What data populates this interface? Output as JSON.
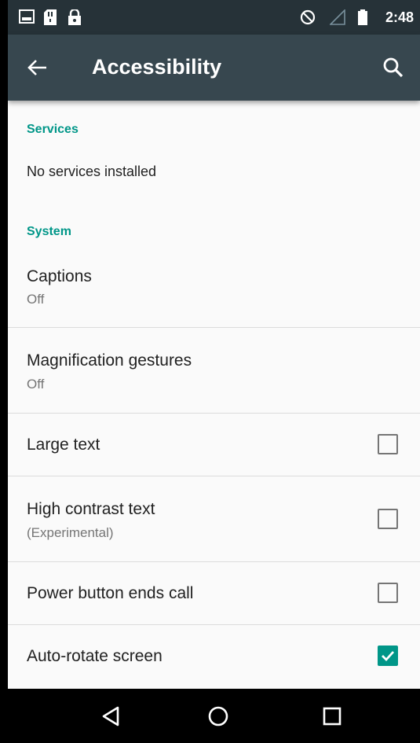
{
  "status_bar": {
    "time": "2:48",
    "icons": [
      "image-icon",
      "sd-card-icon",
      "lock-icon",
      "do-not-disturb-icon",
      "signal-icon",
      "battery-icon"
    ]
  },
  "toolbar": {
    "title": "Accessibility",
    "back_icon": "arrow-back-icon",
    "search_icon": "search-icon"
  },
  "sections": {
    "services": {
      "header": "Services",
      "empty_text": "No services installed"
    },
    "system": {
      "header": "System",
      "items": [
        {
          "title": "Captions",
          "summary": "Off"
        },
        {
          "title": "Magnification gestures",
          "summary": "Off"
        },
        {
          "title": "Large text",
          "checked": false
        },
        {
          "title": "High contrast text",
          "summary": "(Experimental)",
          "checked": false
        },
        {
          "title": "Power button ends call",
          "checked": false
        },
        {
          "title": "Auto-rotate screen",
          "checked": true
        }
      ]
    }
  },
  "nav_bar": {
    "icons": [
      "back-triangle-icon",
      "home-circle-icon",
      "recents-square-icon"
    ]
  },
  "colors": {
    "status_bar": "#263238",
    "toolbar": "#37474f",
    "accent": "#009688",
    "background": "#fafafa"
  }
}
